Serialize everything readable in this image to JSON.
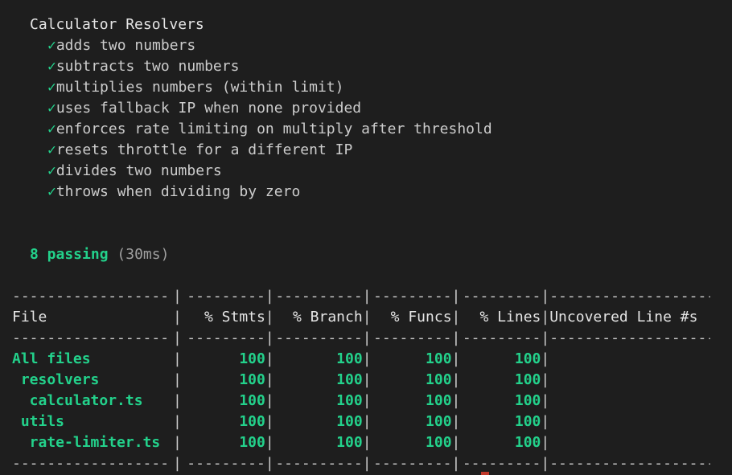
{
  "suite": {
    "title": "Calculator Resolvers",
    "check_glyph": "✓",
    "tests": [
      "adds two numbers",
      "subtracts two numbers",
      "multiplies numbers (within limit)",
      "uses fallback IP when none provided",
      "enforces rate limiting on multiply after threshold",
      "resets throttle for a different IP",
      "divides two numbers",
      "throws when dividing by zero"
    ]
  },
  "summary": {
    "passing": "8 passing",
    "duration": "(30ms)"
  },
  "coverage": {
    "separator": "|",
    "dash_row": {
      "file": "------------------",
      "stmts": "---------",
      "branch": "----------",
      "funcs": "---------",
      "lines": "---------",
      "uncov": "-------------------"
    },
    "header": {
      "file": "File",
      "stmts": "% Stmts",
      "branch": "% Branch",
      "funcs": "% Funcs",
      "lines": "% Lines",
      "uncov": "Uncovered Line #s"
    },
    "rows": [
      {
        "file": "All files",
        "stmts": "100",
        "branch": "100",
        "funcs": "100",
        "lines": "100",
        "uncov": ""
      },
      {
        "file": " resolvers",
        "stmts": "100",
        "branch": "100",
        "funcs": "100",
        "lines": "100",
        "uncov": ""
      },
      {
        "file": "  calculator.ts",
        "stmts": "100",
        "branch": "100",
        "funcs": "100",
        "lines": "100",
        "uncov": ""
      },
      {
        "file": " utils",
        "stmts": "100",
        "branch": "100",
        "funcs": "100",
        "lines": "100",
        "uncov": ""
      },
      {
        "file": "  rate-limiter.ts",
        "stmts": "100",
        "branch": "100",
        "funcs": "100",
        "lines": "100",
        "uncov": ""
      }
    ]
  },
  "colors": {
    "background": "#1e1e1e",
    "pass_green": "#23d18b",
    "text": "#cccccc"
  }
}
